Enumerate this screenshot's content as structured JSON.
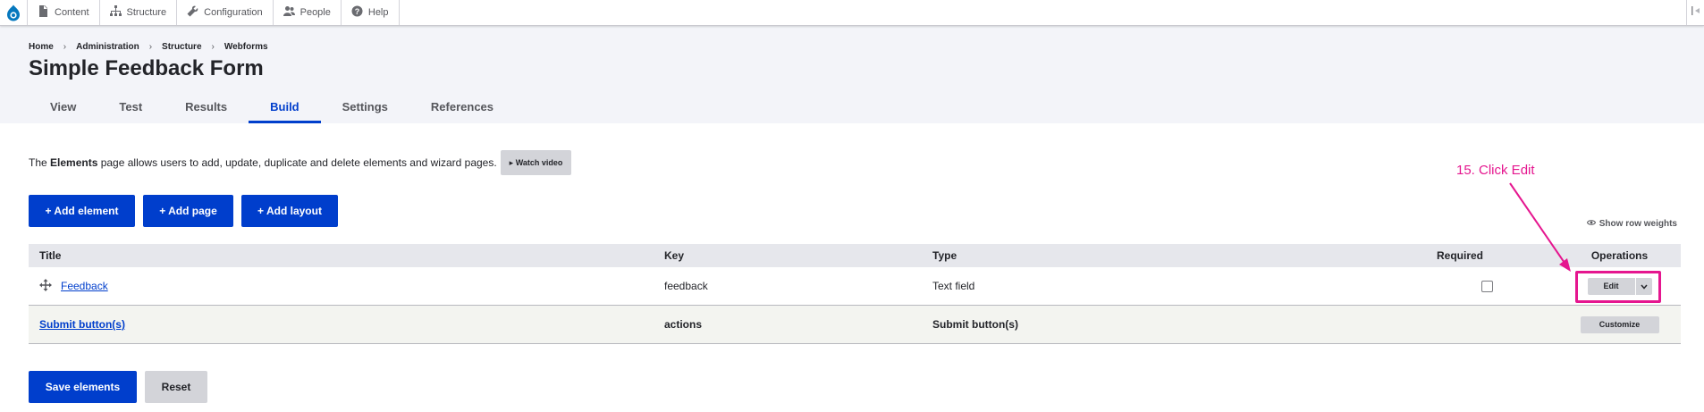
{
  "toolbar": {
    "items": [
      {
        "label": "Content",
        "icon": "content-icon"
      },
      {
        "label": "Structure",
        "icon": "structure-icon"
      },
      {
        "label": "Configuration",
        "icon": "wrench-icon"
      },
      {
        "label": "People",
        "icon": "people-icon"
      },
      {
        "label": "Help",
        "icon": "help-icon"
      }
    ]
  },
  "breadcrumb": [
    "Home",
    "Administration",
    "Structure",
    "Webforms"
  ],
  "breadcrumb_separator": "›",
  "page_title": "Simple Feedback Form",
  "tabs": [
    {
      "label": "View",
      "active": false
    },
    {
      "label": "Test",
      "active": false
    },
    {
      "label": "Results",
      "active": false
    },
    {
      "label": "Build",
      "active": true
    },
    {
      "label": "Settings",
      "active": false
    },
    {
      "label": "References",
      "active": false
    }
  ],
  "intro": {
    "prefix": "The ",
    "bold": "Elements",
    "suffix": " page allows users to add, update, duplicate and delete elements and wizard pages.",
    "watch_video": "▸ Watch video"
  },
  "actions": {
    "add_element": "+ Add element",
    "add_page": "+ Add page",
    "add_layout": "+ Add layout"
  },
  "show_row_weights": "Show row weights",
  "table": {
    "headers": {
      "title": "Title",
      "key": "Key",
      "type": "Type",
      "required": "Required",
      "operations": "Operations"
    },
    "rows": [
      {
        "title": "Feedback",
        "key": "feedback",
        "type": "Text field",
        "required": false,
        "operation": "Edit"
      },
      {
        "title": "Submit button(s)",
        "key": "actions",
        "type": "Submit button(s)",
        "operation": "Customize"
      }
    ]
  },
  "annotation": {
    "text": "15. Click Edit",
    "color": "#e5168f"
  },
  "bottom": {
    "save": "Save elements",
    "reset": "Reset"
  },
  "colors": {
    "accent": "#003ecc",
    "annotation": "#e5168f",
    "header_bg": "#f3f4f9"
  }
}
